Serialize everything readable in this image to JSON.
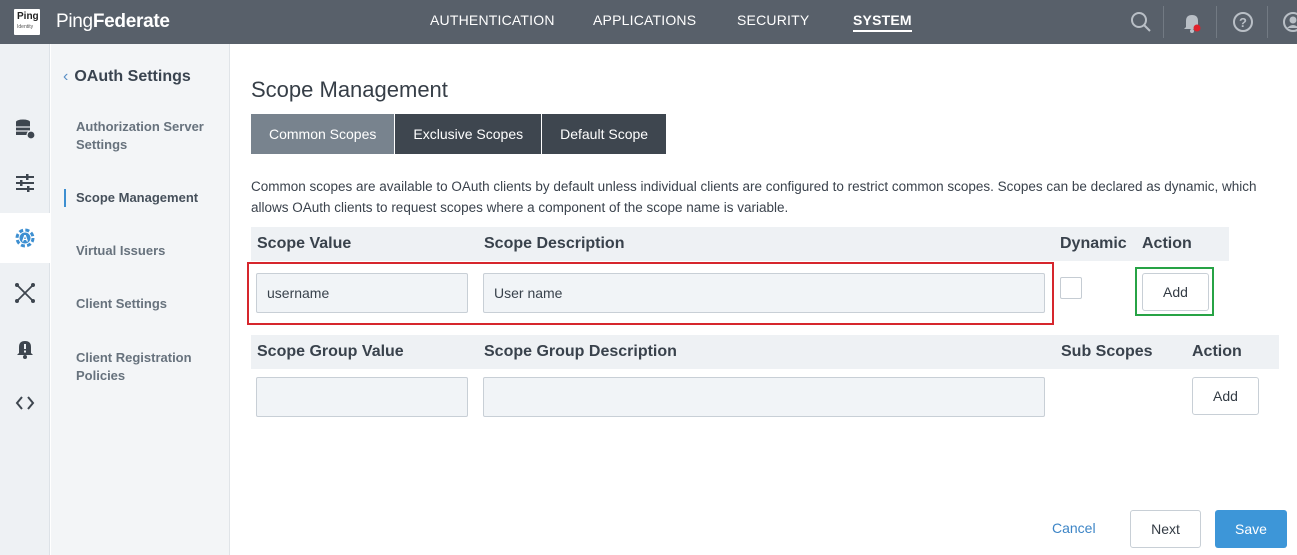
{
  "header": {
    "logo_text": "Ping",
    "logo_subtext": "Identity",
    "brand_first": "Ping",
    "brand_second": "Federate",
    "nav": [
      {
        "label": "AUTHENTICATION"
      },
      {
        "label": "APPLICATIONS"
      },
      {
        "label": "SECURITY"
      },
      {
        "label": "SYSTEM",
        "active": true
      }
    ],
    "icons": [
      "search-icon",
      "notifications-bell-icon",
      "help-icon",
      "user-avatar-icon"
    ],
    "notification_dot_color": "#e0212b"
  },
  "rail": {
    "icons": [
      "data-store-icon",
      "sliders-icon",
      "oauth-gear-icon",
      "network-nodes-icon",
      "alert-bell-icon",
      "code-brackets-icon"
    ],
    "active_index": 2
  },
  "sidebar": {
    "back_label": "OAuth Settings",
    "items": [
      {
        "label": "Authorization Server Settings"
      },
      {
        "label": "Scope Management",
        "active": true
      },
      {
        "label": "Virtual Issuers"
      },
      {
        "label": "Client Settings"
      },
      {
        "label": "Client Registration Policies"
      }
    ]
  },
  "main": {
    "title": "Scope Management",
    "tabs": [
      {
        "label": "Common Scopes",
        "active": true
      },
      {
        "label": "Exclusive Scopes"
      },
      {
        "label": "Default Scope"
      }
    ],
    "description": "Common scopes are available to OAuth clients by default unless individual clients are configured to restrict common scopes. Scopes can be declared as dynamic, which allows OAuth clients to request scopes where a component of the scope name is variable.",
    "scopes_table": {
      "headers": {
        "value": "Scope Value",
        "description": "Scope Description",
        "dynamic": "Dynamic",
        "action": "Action"
      },
      "row": {
        "value": "username",
        "description": "User name",
        "dynamic_checked": false,
        "action_label": "Add"
      }
    },
    "groups_table": {
      "headers": {
        "value": "Scope Group Value",
        "description": "Scope Group Description",
        "sub_scopes": "Sub Scopes",
        "action": "Action"
      },
      "row": {
        "value": "",
        "description": "",
        "action_label": "Add"
      }
    }
  },
  "footer": {
    "cancel_label": "Cancel",
    "next_label": "Next",
    "save_label": "Save"
  },
  "highlights": {
    "red": "#d6262d",
    "green": "#27a345"
  }
}
